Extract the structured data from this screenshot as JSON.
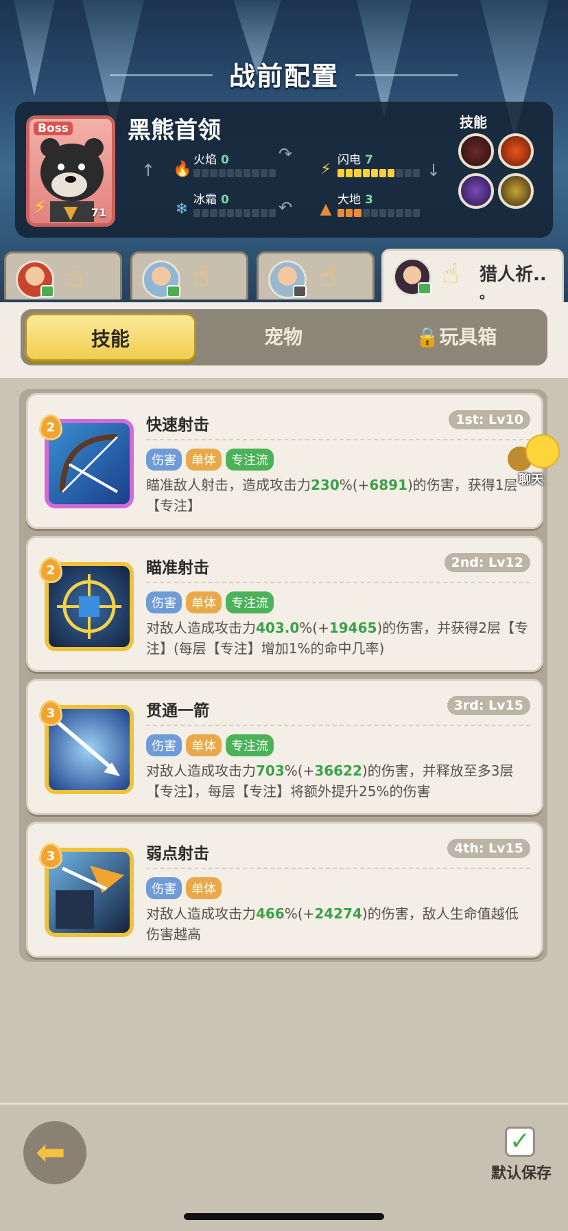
{
  "header": {
    "title": "战前配置"
  },
  "boss": {
    "badge": "Boss",
    "name": "黑熊首领",
    "level": "71",
    "skills_label": "技能",
    "stats": [
      {
        "name": "火焰",
        "value": "0",
        "filled": 0,
        "color": "#e4483a",
        "icon": "fire-icon"
      },
      {
        "name": "闪电",
        "value": "7",
        "filled": 7,
        "color": "#ffcf3a",
        "icon": "lightning-icon"
      },
      {
        "name": "冰霜",
        "value": "0",
        "filled": 0,
        "color": "#7cc6ef",
        "icon": "snowflake-icon"
      },
      {
        "name": "大地",
        "value": "3",
        "filled": 3,
        "color": "#e88b3a",
        "icon": "earth-icon"
      }
    ],
    "skill_icons": [
      "bite-skill-icon",
      "fire-bite-skill-icon",
      "dark-skill-icon",
      "shadow-skill-icon"
    ]
  },
  "heroes": [
    {
      "name": "",
      "avatar": "red-hair-hero-avatar"
    },
    {
      "name": "",
      "avatar": "silver-hair-hero-avatar"
    },
    {
      "name": "",
      "avatar": "silver-hair-hero-2-avatar"
    },
    {
      "name": "猎人祈..",
      "name2": "。",
      "avatar": "hunter-hero-avatar",
      "active": true
    }
  ],
  "tabs": {
    "skills": "技能",
    "pets": "宠物",
    "toybox": "玩具箱"
  },
  "skills": [
    {
      "level_badge": "2",
      "name": "快速射击",
      "rank": "1st: Lv10",
      "tags": [
        "伤害",
        "单体",
        "专注流"
      ],
      "desc_parts": [
        "瞄准敌人射击，造成攻击力",
        "230",
        "%(+",
        "6891",
        ")的伤害，获得1层【专注】"
      ]
    },
    {
      "level_badge": "2",
      "name": "瞄准射击",
      "rank": "2nd: Lv12",
      "tags": [
        "伤害",
        "单体",
        "专注流"
      ],
      "desc_parts": [
        "对敌人造成攻击力",
        "403.0",
        "%(+",
        "19465",
        ")的伤害，并获得2层【专注】(每层【专注】增加1%的命中几率)"
      ]
    },
    {
      "level_badge": "3",
      "name": "贯通一箭",
      "rank": "3rd: Lv15",
      "tags": [
        "伤害",
        "单体",
        "专注流"
      ],
      "desc_parts": [
        "对敌人造成攻击力",
        "703",
        "%(+",
        "36622",
        ")的伤害，并释放至多3层【专注】，每层【专注】将额外提升25%的伤害"
      ]
    },
    {
      "level_badge": "3",
      "name": "弱点射击",
      "rank": "4th: Lv15",
      "tags": [
        "伤害",
        "单体"
      ],
      "desc_parts": [
        "对敌人造成攻击力",
        "466",
        "%(+",
        "24274",
        ")的伤害，敌人生命值越低伤害越高"
      ]
    }
  ],
  "chat": {
    "label": "聊天"
  },
  "footer": {
    "save_label": "默认保存"
  }
}
